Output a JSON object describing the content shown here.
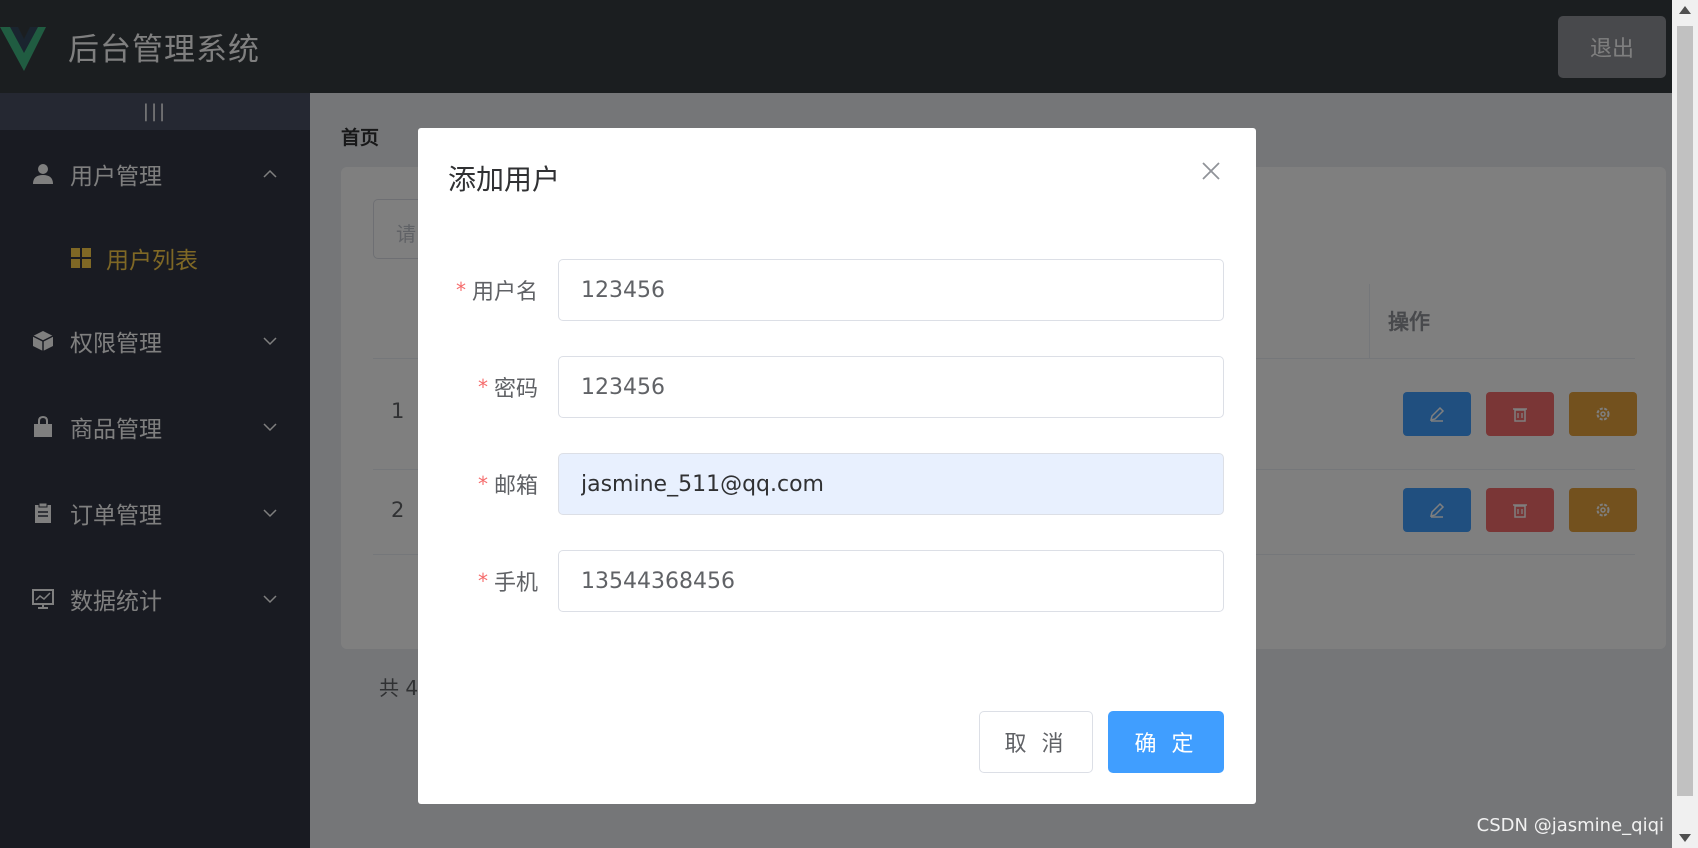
{
  "header": {
    "title": "后台管理系统",
    "logout_label": "退出"
  },
  "sidebar": {
    "toggle_label": "|||",
    "menus": [
      {
        "label": "用户管理",
        "icon": "user-icon",
        "expanded": true,
        "children": [
          {
            "label": "用户列表",
            "icon": "grid-icon",
            "active": true
          }
        ]
      },
      {
        "label": "权限管理",
        "icon": "box-icon",
        "expanded": false
      },
      {
        "label": "商品管理",
        "icon": "bag-icon",
        "expanded": false
      },
      {
        "label": "订单管理",
        "icon": "clipboard-icon",
        "expanded": false
      },
      {
        "label": "数据统计",
        "icon": "monitor-chart-icon",
        "expanded": false
      }
    ]
  },
  "main": {
    "breadcrumb_home": "首页",
    "search_placeholder": "请",
    "table": {
      "op_header": "操作",
      "rows": [
        {
          "index": "1"
        },
        {
          "index": "2"
        }
      ]
    },
    "total_text": "共 4"
  },
  "dialog": {
    "title": "添加用户",
    "fields": [
      {
        "label": "用户名",
        "value": "123456"
      },
      {
        "label": "密码",
        "value": "123456"
      },
      {
        "label": "邮箱",
        "value": "jasmine_511@qq.com"
      },
      {
        "label": "手机",
        "value": "13544368456"
      }
    ],
    "required_mark": "*",
    "cancel_label": "取 消",
    "confirm_label": "确 定"
  },
  "watermark": "CSDN @jasmine_qiqi",
  "colors": {
    "primary": "#409eff",
    "danger": "#f56c6c",
    "warning": "#e6a23c",
    "menu_active": "#ffd04b",
    "sidebar_bg": "#333744",
    "header_bg": "#373d41"
  }
}
